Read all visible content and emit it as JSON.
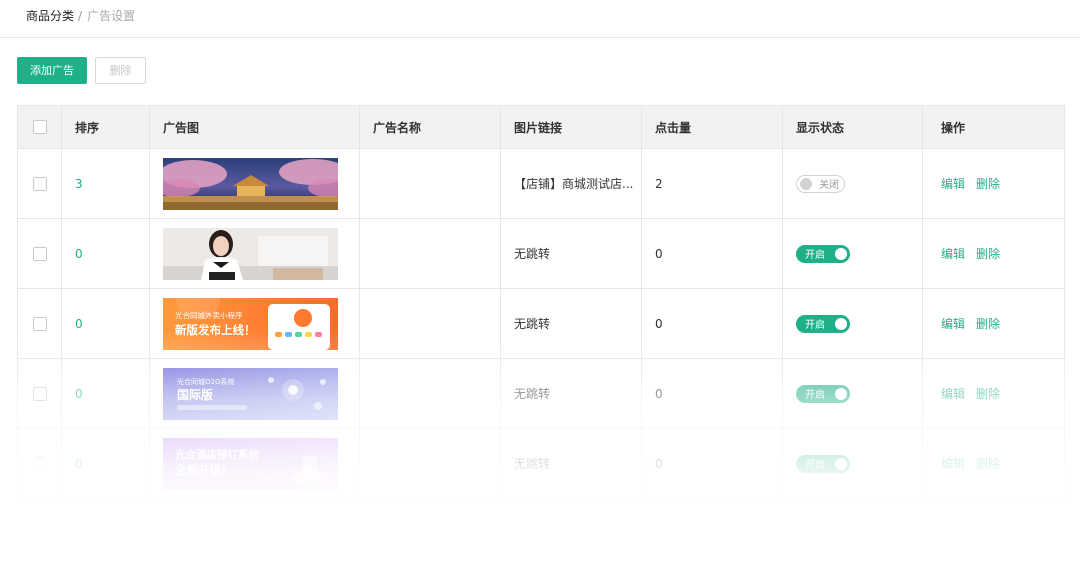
{
  "breadcrumb": {
    "parent": "商品分类",
    "separator": "/",
    "current": "广告设置"
  },
  "toolbar": {
    "add_label": "添加广告",
    "delete_label": "删除"
  },
  "table": {
    "headers": {
      "sort": "排序",
      "image": "广告图",
      "name": "广告名称",
      "link": "图片链接",
      "clicks": "点击量",
      "status": "显示状态",
      "ops": "操作"
    },
    "edit_label": "编辑",
    "delete_label": "删除",
    "rows": [
      {
        "sort": "3",
        "name": "",
        "link": "【店铺】商城测试店...",
        "clicks": "2",
        "status": "关闭",
        "status_on": false,
        "image_icon": "cherry-blossom-banner"
      },
      {
        "sort": "0",
        "name": "",
        "link": "无跳转",
        "clicks": "0",
        "status": "开启",
        "status_on": true,
        "image_icon": "woman-portrait-banner"
      },
      {
        "sort": "0",
        "name": "",
        "link": "无跳转",
        "clicks": "0",
        "status": "开启",
        "status_on": true,
        "image_icon": "miniapp-release-banner",
        "banner_text": [
          "光合同城外卖小程序",
          "新版发布上线！"
        ]
      },
      {
        "sort": "0",
        "name": "",
        "link": "无跳转",
        "clicks": "0",
        "status": "开启",
        "status_on": true,
        "image_icon": "o2o-international-banner",
        "banner_text": [
          "光合同城O2O系统",
          "国际版"
        ]
      },
      {
        "sort": "0",
        "name": "",
        "link": "无跳转",
        "clicks": "0",
        "status": "开启",
        "status_on": true,
        "image_icon": "hotel-booking-banner",
        "banner_text": [
          "光合酒店预订系统",
          "全新升级！"
        ]
      }
    ]
  },
  "colors": {
    "accent": "#20b089",
    "header_bg": "#f2f2f2",
    "border": "#e6e6e6"
  }
}
